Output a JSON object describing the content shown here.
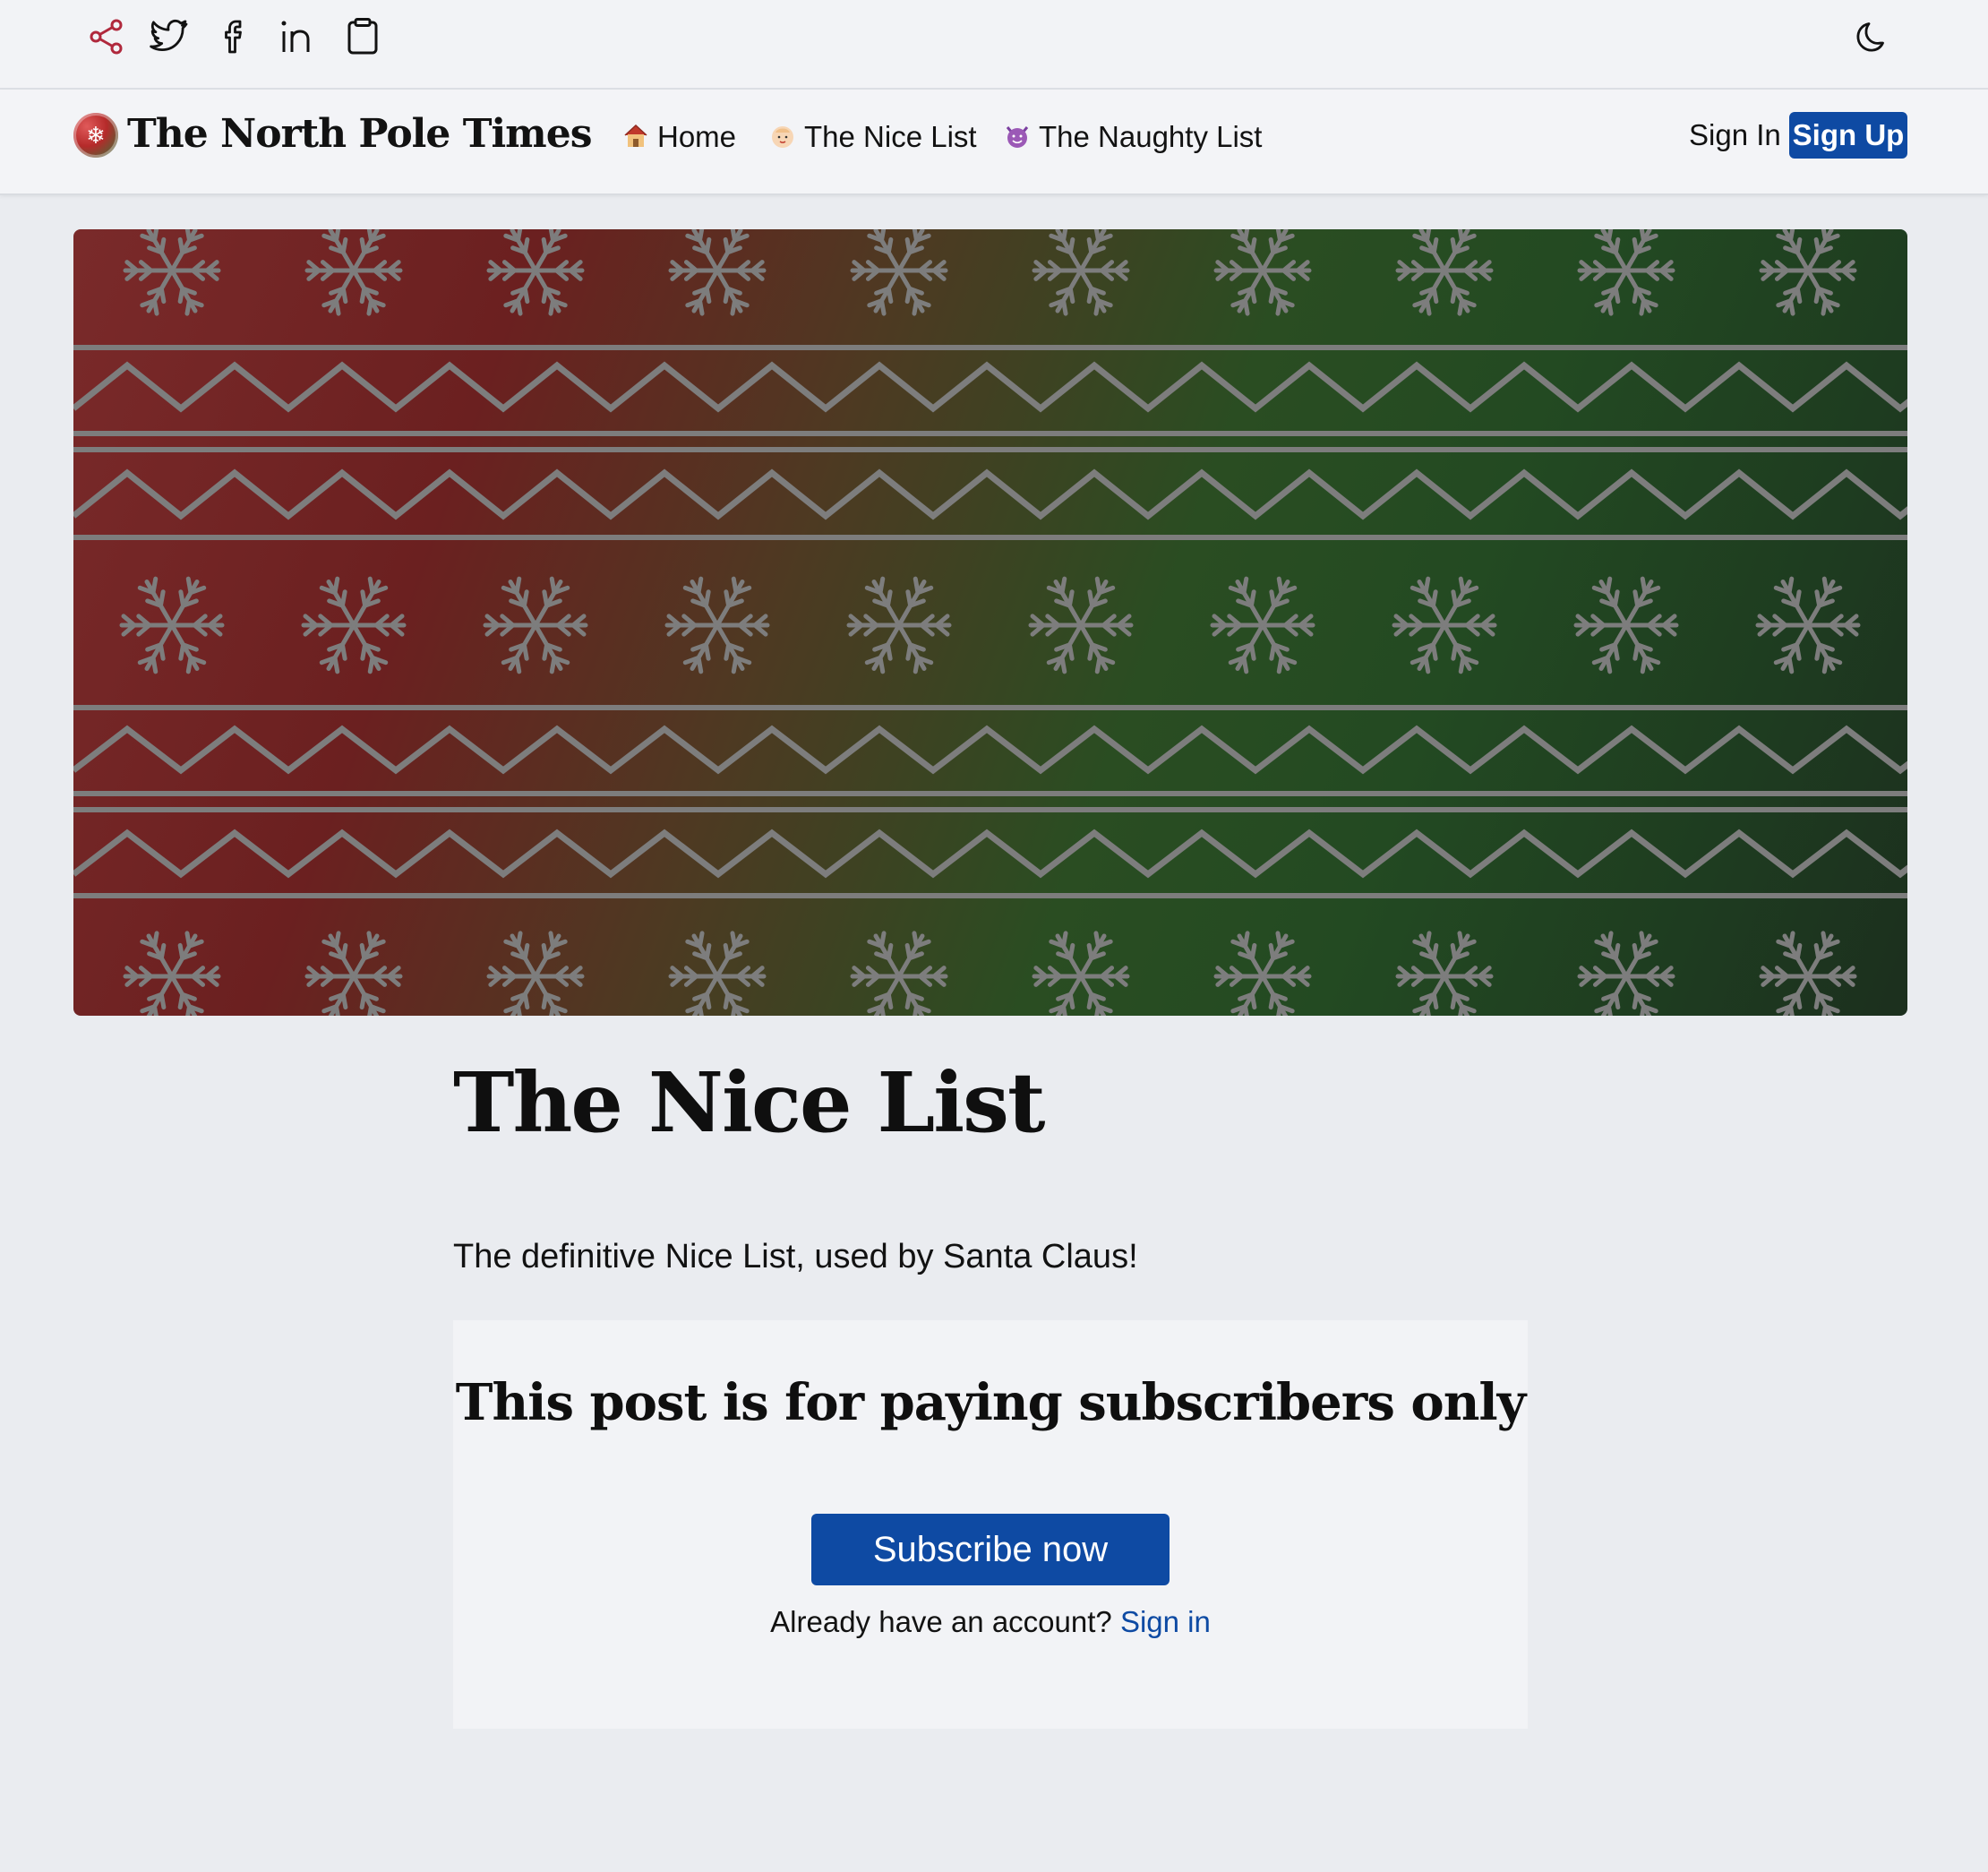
{
  "share_bar": {
    "icons": [
      "share-icon",
      "twitter-icon",
      "facebook-icon",
      "linkedin-icon",
      "clipboard-icon"
    ],
    "theme_toggle_icon": "moon-icon",
    "share_color": "#b0283c"
  },
  "header": {
    "site_title": "The North Pole Times",
    "logo_icon": "snowflake-badge-icon",
    "nav": [
      {
        "label": "Home",
        "icon": "house-icon"
      },
      {
        "label": "The Nice List",
        "icon": "baby-face-icon"
      },
      {
        "label": "The Naughty List",
        "icon": "smiling-devil-icon"
      }
    ],
    "sign_in_label": "Sign In",
    "sign_up_label": "Sign Up"
  },
  "hero": {
    "image_description_icon": "christmas-sweater-pattern",
    "gradient_colors": [
      "#7a2a2a",
      "#234a22",
      "#1c2f1e"
    ]
  },
  "article": {
    "title": "The Nice List",
    "excerpt": "The definitive Nice List, used by Santa Claus!"
  },
  "paywall": {
    "heading": "This post is for paying subscribers only",
    "subscribe_label": "Subscribe now",
    "account_prompt": "Already have an account?",
    "sign_in_link": "Sign in"
  },
  "colors": {
    "accent": "#0e4aa3",
    "background": "#eaecf0",
    "card": "#f2f3f6"
  }
}
